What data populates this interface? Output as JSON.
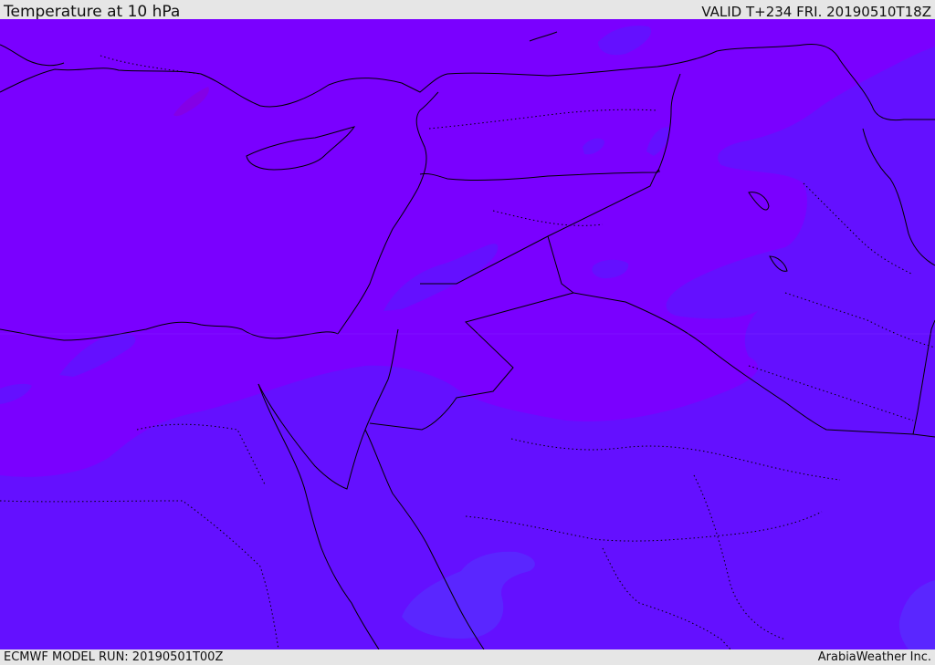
{
  "header": {
    "title": "Temperature at 10 hPa",
    "valid": "VALID T+234 FRI. 20190510T18Z"
  },
  "footer": {
    "model_run": "ECMWF MODEL RUN: 20190501T00Z",
    "credit": "ArabiaWeather Inc."
  },
  "map": {
    "fill_colors": {
      "band_warm": "#7a00ff",
      "band_cool": "#6410ff",
      "band_coolest": "#5a26ff",
      "band_warmest": "#8400e6"
    },
    "coastline_color": "#000000",
    "border_color": "#000000"
  }
}
